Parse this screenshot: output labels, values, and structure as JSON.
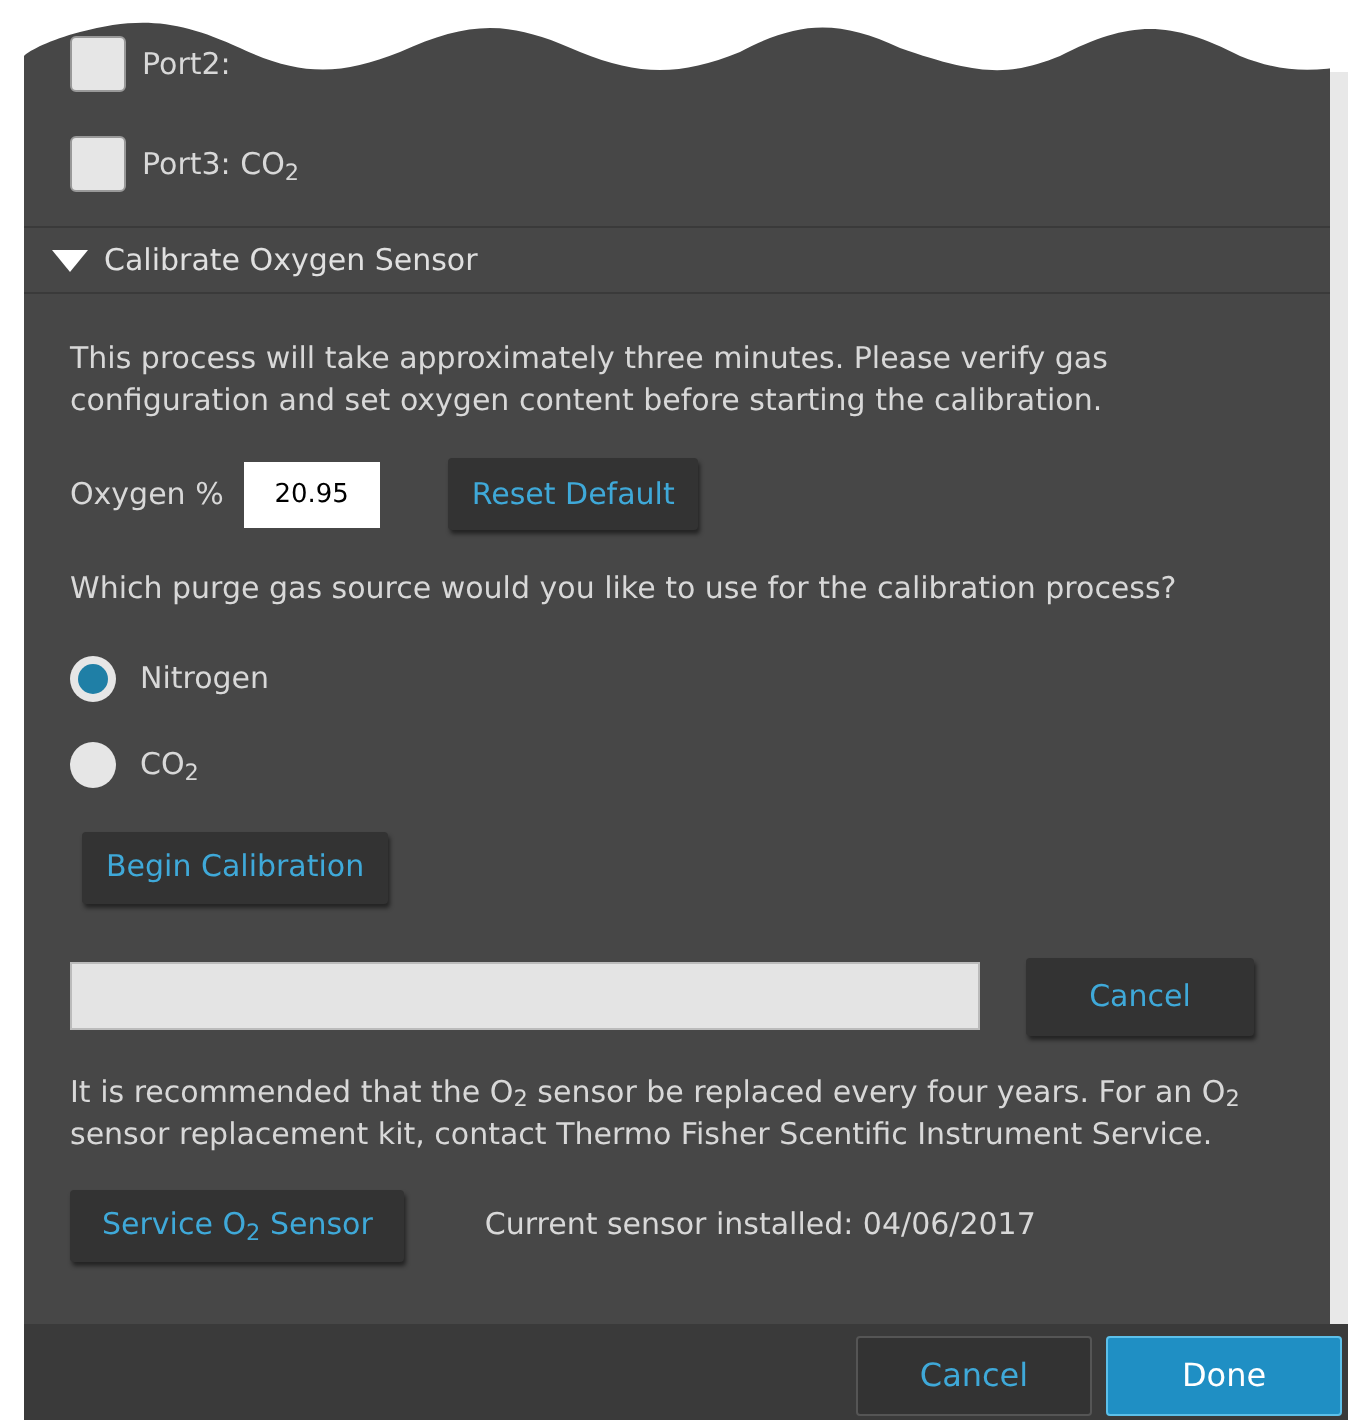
{
  "ports": [
    {
      "label": "Port2:",
      "checked": false
    },
    {
      "label": "Port3: CO$_{2}$",
      "checked": false
    }
  ],
  "section": {
    "title": "Calibrate Oxygen Sensor",
    "expanded": true
  },
  "intro": "This process will take approximately three minutes. Please verify gas configuration and set oxygen content before starting the calibration.",
  "oxygen": {
    "label": "Oxygen %",
    "value": "20.95",
    "reset_button": "Reset Default"
  },
  "question": "Which purge gas source would you like to use for the calibration process?",
  "gas_options": [
    {
      "label": "Nitrogen",
      "selected": true
    },
    {
      "label": "CO$_{2}$",
      "selected": false
    }
  ],
  "begin_button": "Begin Calibration",
  "progress": {
    "level": 0,
    "cancel_button": "Cancel"
  },
  "notice": "It is recommended that the O$_{2}$ sensor be replaced every four years. For an O$_{2}$ sensor replacement kit, contact Thermo Fisher Scentific Instrument Service.",
  "service_button": "Service O$_{2}$ Sensor",
  "installed": "Current sensor installed: 04/06/2017",
  "footer": {
    "cancel_button": "Cancel",
    "done_button": "Done"
  }
}
